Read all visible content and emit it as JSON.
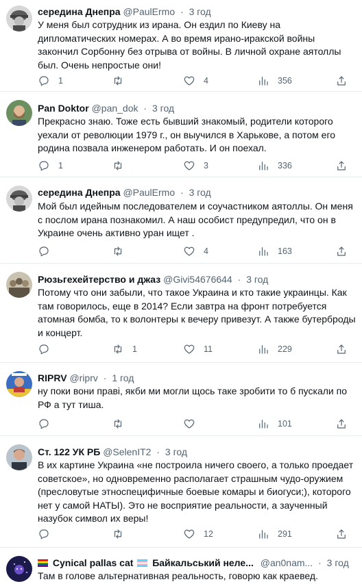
{
  "tweets": [
    {
      "name": "середина Днепра",
      "handle": "@PaulErmo",
      "time": "3 год",
      "avatar": "soldier-helmet-avatar",
      "text": "У меня был сотрудник из ирана. Он ездил по Киеву на дипломатических номерах. А во время ирано-иракской войны закончил Сорбонну без отрыва от войны. В личной охране аятоллы был. Очень непростые они!",
      "replies": "1",
      "retweets": "",
      "likes": "4",
      "views": "356"
    },
    {
      "name": "Pan Doktor",
      "handle": "@pan_dok",
      "time": "3 год",
      "avatar": "bearded-man-avatar",
      "text": "Прекрасно знаю. Тоже есть бывший знакомый, родители которого уехали от революции 1979 г., он выучился в Харькове, а потом его родина позвала инженером работать. И он поехал.",
      "replies": "1",
      "retweets": "",
      "likes": "3",
      "views": "336"
    },
    {
      "name": "середина Днепра",
      "handle": "@PaulErmo",
      "time": "3 год",
      "avatar": "soldier-helmet-avatar",
      "text": "Мой был идейным последователем и соучастником аятоллы. Он меня с послом ирана познакомил. А наш особист предупредил, что он в Украине очень активно уран ищет .",
      "replies": "",
      "retweets": "",
      "likes": "4",
      "views": "163"
    },
    {
      "name": "Рюзьгехейтерство и джаз",
      "handle": "@Givi54676644",
      "time": "3 год",
      "avatar": "group-photo-avatar",
      "text": "Потому что они забыли, что такое Украина и кто такие украинцы. Как там говорилось, еще в 2014? Если завтра на фронт потребуется атомная бомба, то к волонтеры к вечеру привезут. А также бутерброды и концерт.",
      "replies": "",
      "retweets": "1",
      "likes": "11",
      "views": "229"
    },
    {
      "name": "RIPRV",
      "handle": "@riprv",
      "time": "1 год",
      "avatar": "portrait-avatar",
      "text": "ну поки вони праві, якби ми могли щось таке зробити то б пускали по РФ а тут тиша.",
      "replies": "",
      "retweets": "",
      "likes": "",
      "views": "101"
    },
    {
      "name": "Ст. 122 УК РБ",
      "handle": "@SelenIT2",
      "time": "3 год",
      "avatar": "man-portrait-avatar",
      "text": "В их картине Украина «не построила ничего своего, а только проедает советское», но одновременно располагает страшным чудо-оружием (пресловутые этноспецифичные боевые комары и биогуси;), которого нет у самой НАТЫ). Это не восприятие реальности, а заученный назубок символ их веры!",
      "replies": "",
      "retweets": "",
      "likes": "12",
      "views": "291"
    },
    {
      "name": "Cynical pallas cat",
      "name2": "Байкальський неле...",
      "handle": "@an0nam...",
      "time": "3 год",
      "avatar": "pallas-cat-avatar",
      "text": "Там в голове альтернативная реальность, говорю как краевед.",
      "replies": "",
      "retweets": "",
      "likes": "",
      "views": ""
    }
  ]
}
